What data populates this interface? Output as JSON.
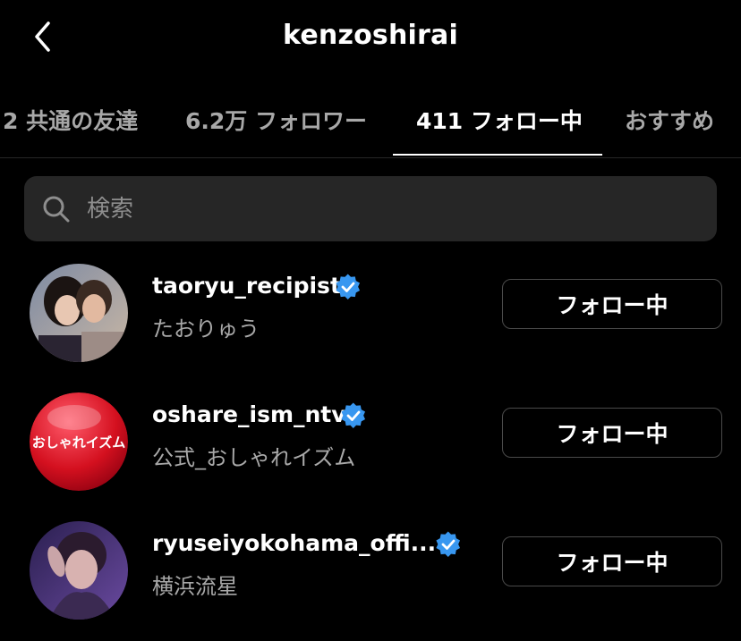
{
  "header": {
    "title": "kenzoshirai"
  },
  "tabs": [
    {
      "label": "2 共通の友達"
    },
    {
      "label": "6.2万 フォロワー"
    },
    {
      "label": "411 フォロー中"
    },
    {
      "label": "おすすめ"
    }
  ],
  "active_tab": 2,
  "search": {
    "placeholder": "検索",
    "value": ""
  },
  "accounts": [
    {
      "username": "taoryu_recipist",
      "display_name": "たおりゅう",
      "verified": true,
      "button": "フォロー中"
    },
    {
      "username": "oshare_ism_ntv",
      "display_name": "公式_おしゃれイズム",
      "verified": true,
      "button": "フォロー中",
      "avatar_text": "おしゃれイズム"
    },
    {
      "username": "ryuseiyokohama_offi...",
      "display_name": "横浜流星",
      "verified": true,
      "button": "フォロー中"
    }
  ],
  "colors": {
    "background": "#000000",
    "verified": "#3897f0",
    "secondary_text": "#a8a8a8",
    "search_bg": "#262626"
  }
}
